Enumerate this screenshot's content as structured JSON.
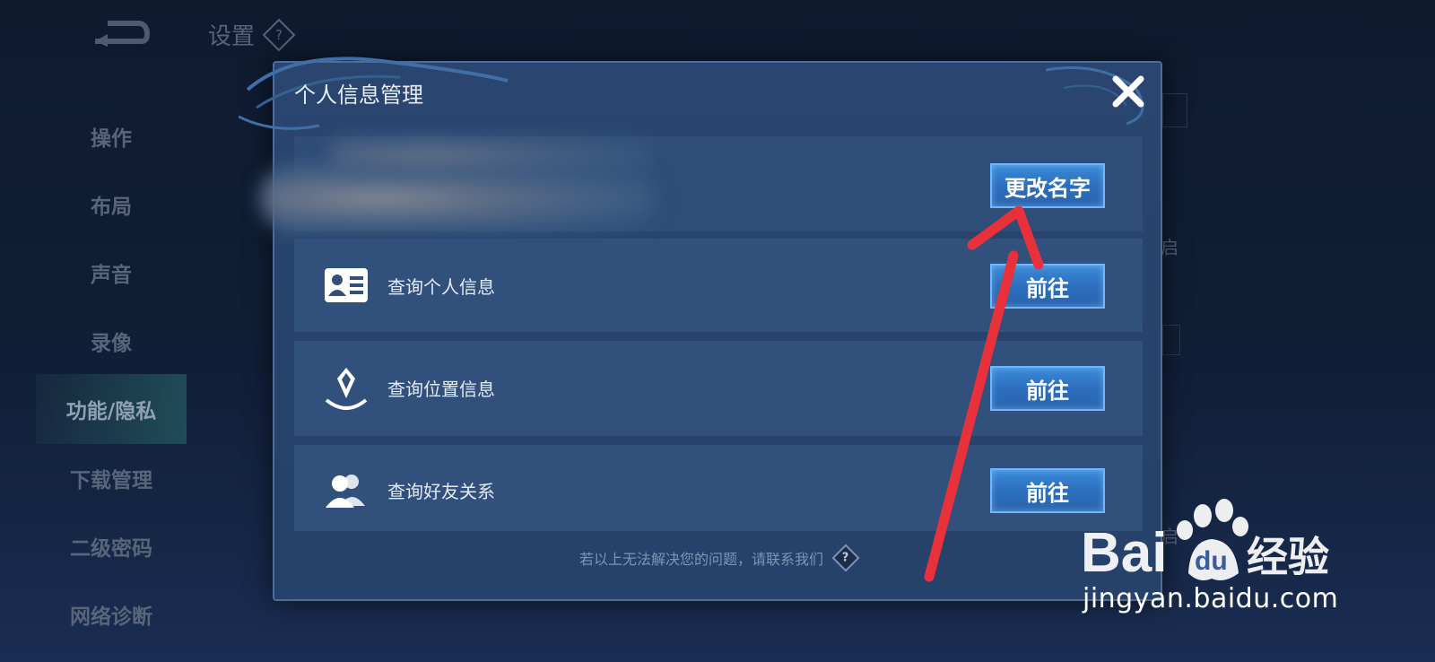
{
  "background": {
    "title": "设置",
    "help_glyph": "?",
    "sidebar_items": [
      {
        "label": "操作"
      },
      {
        "label": "布局"
      },
      {
        "label": "声音"
      },
      {
        "label": "录像"
      },
      {
        "label": "功能/隐私",
        "active": true
      },
      {
        "label": "下载管理"
      },
      {
        "label": "二级密码"
      },
      {
        "label": "网络诊断"
      }
    ],
    "right_fragments": [
      "启",
      "启"
    ]
  },
  "modal": {
    "title": "个人信息管理",
    "change_name_button": "更改名字",
    "rows": [
      {
        "icon": "id-card-icon",
        "label": "查询个人信息",
        "button": "前往"
      },
      {
        "icon": "location-pin-icon",
        "label": "查询位置信息",
        "button": "前往"
      },
      {
        "icon": "friends-icon",
        "label": "查询好友关系",
        "button": "前往"
      }
    ],
    "footer_note": "若以上无法解决您的问题，请联系我们",
    "footer_help_glyph": "?"
  },
  "watermark": {
    "brand": "Bai du 经验",
    "url": "jingyan.baidu.com"
  },
  "colors": {
    "button_blue": "#2c6fbd",
    "annotation_red": "#e8313a"
  }
}
